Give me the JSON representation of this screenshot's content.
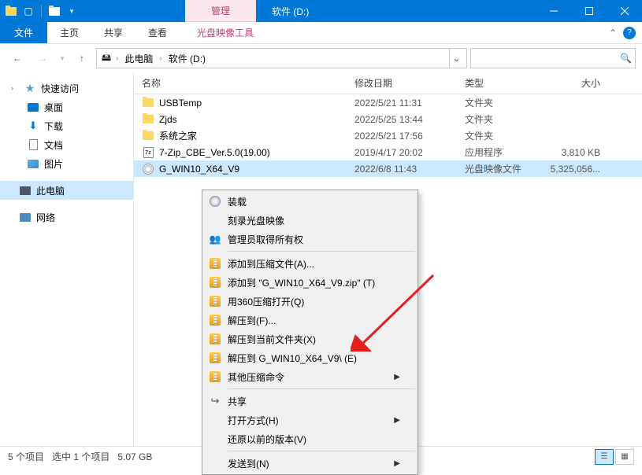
{
  "titlebar": {
    "manage_tab": "管理",
    "title": "软件 (D:)"
  },
  "ribbon": {
    "file": "文件",
    "tabs": [
      "主页",
      "共享",
      "查看"
    ],
    "tool_tab": "光盘映像工具"
  },
  "breadcrumb": {
    "items": [
      "此电脑",
      "软件 (D:)"
    ]
  },
  "search": {
    "icon_hint": "🔍"
  },
  "sidebar": {
    "quick_access": "快速访问",
    "desktop": "桌面",
    "downloads": "下载",
    "documents": "文档",
    "pictures": "图片",
    "this_pc": "此电脑",
    "network": "网络"
  },
  "columns": {
    "name": "名称",
    "date": "修改日期",
    "type": "类型",
    "size": "大小"
  },
  "files": [
    {
      "name": "USBTemp",
      "date": "2022/5/21 11:31",
      "type": "文件夹",
      "size": "",
      "icon": "folder"
    },
    {
      "name": "Zjds",
      "date": "2022/5/25 13:44",
      "type": "文件夹",
      "size": "",
      "icon": "folder"
    },
    {
      "name": "系统之家",
      "date": "2022/5/21 17:56",
      "type": "文件夹",
      "size": "",
      "icon": "folder"
    },
    {
      "name": "7-Zip_CBE_Ver.5.0(19.00)",
      "date": "2019/4/17 20:02",
      "type": "应用程序",
      "size": "3,810 KB",
      "icon": "7z"
    },
    {
      "name": "G_WIN10_X64_V9",
      "date": "2022/6/8 11:43",
      "type": "光盘映像文件",
      "size": "5,325,056...",
      "icon": "iso"
    }
  ],
  "context_menu": {
    "mount": "装载",
    "burn": "刻录光盘映像",
    "admin": "管理员取得所有权",
    "add_archive": "添加到压缩文件(A)...",
    "add_named": "添加到 \"G_WIN10_X64_V9.zip\" (T)",
    "open_360": "用360压缩打开(Q)",
    "extract_to": "解压到(F)...",
    "extract_here": "解压到当前文件夹(X)",
    "extract_named": "解压到 G_WIN10_X64_V9\\ (E)",
    "other_compress": "其他压缩命令",
    "share": "共享",
    "open_with": "打开方式(H)",
    "restore_versions": "还原以前的版本(V)",
    "send_to": "发送到(N)"
  },
  "status": {
    "count": "5 个项目",
    "selection": "选中 1 个项目",
    "size": "5.07 GB"
  }
}
